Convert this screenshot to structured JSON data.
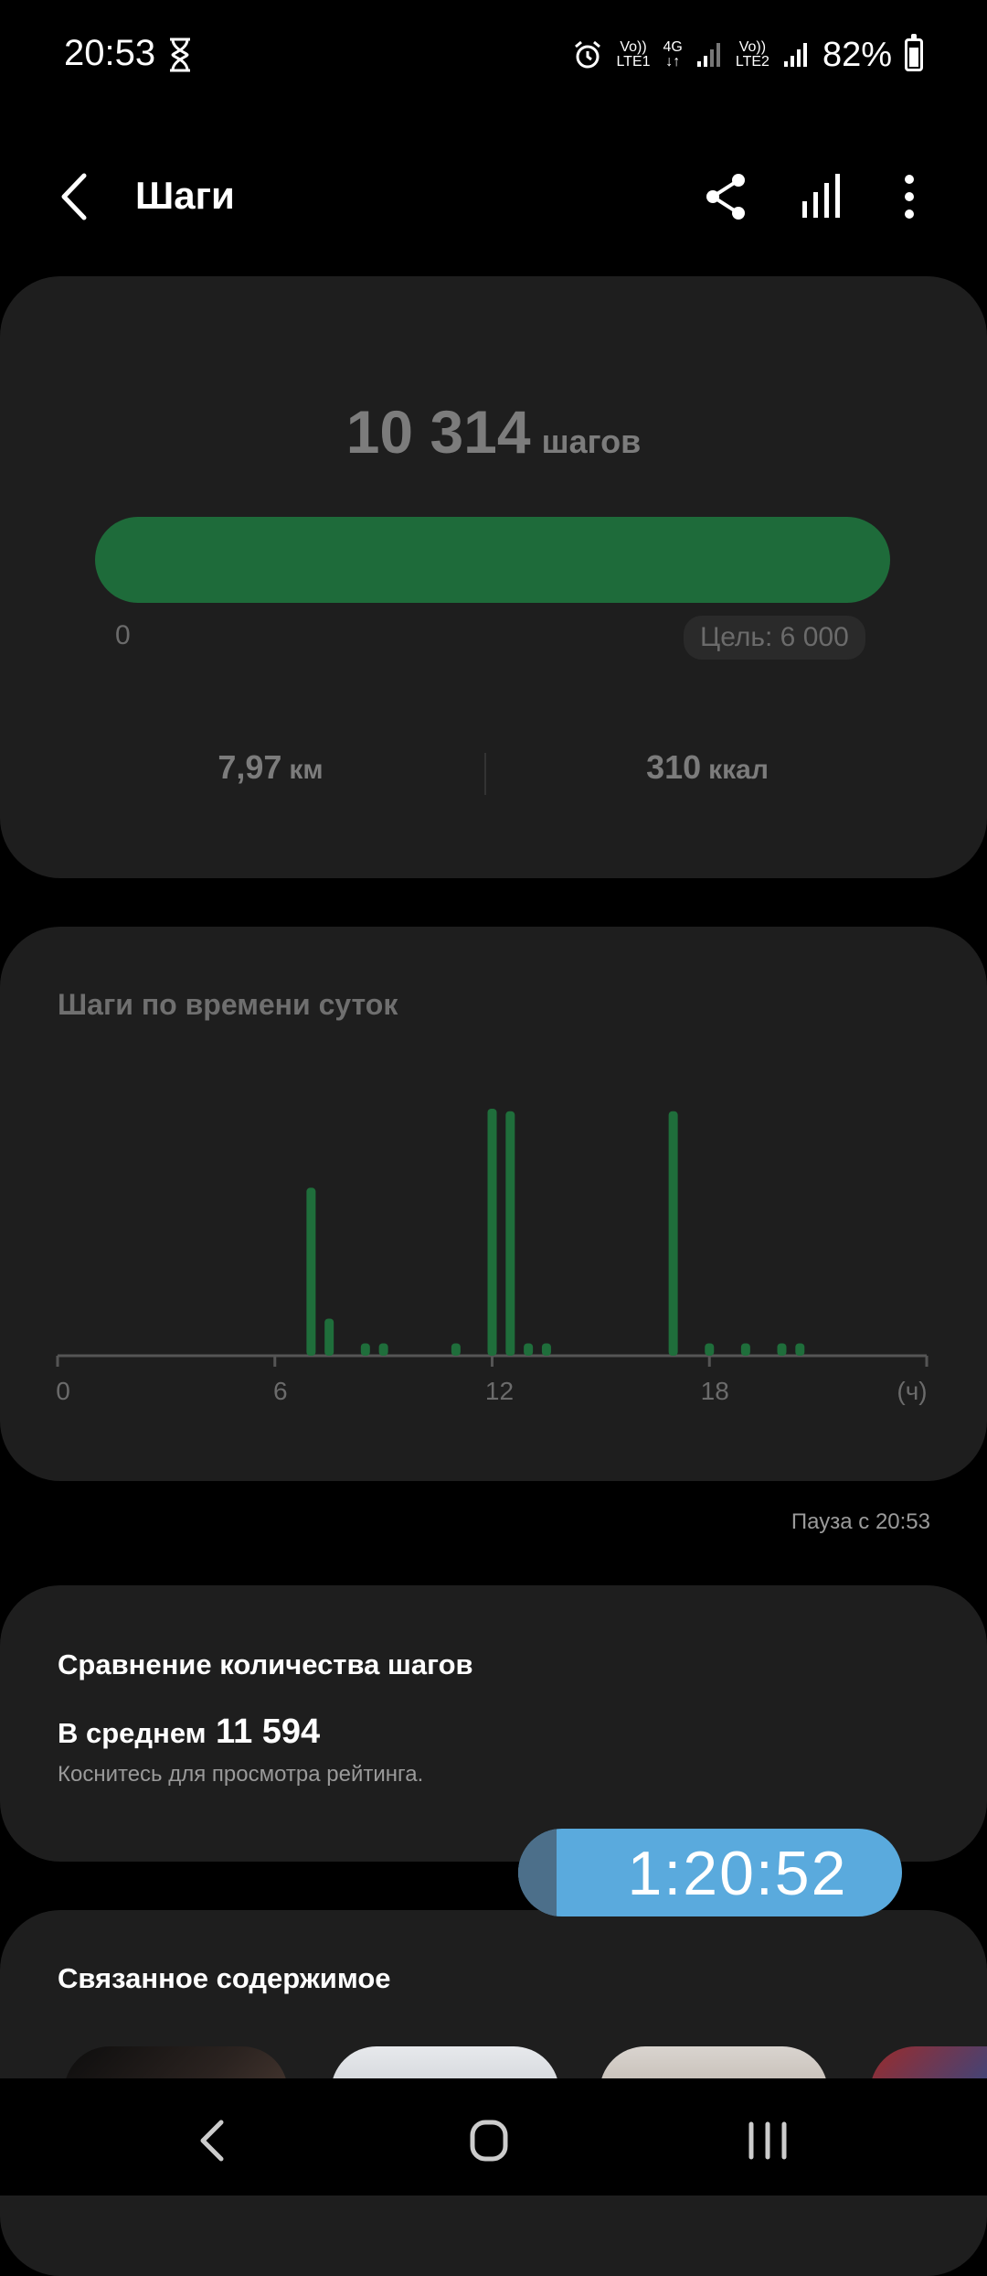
{
  "status_bar": {
    "time": "20:53",
    "sim1_top": "Vo))",
    "sim1_bottom": "LTE1",
    "network": "4G",
    "sim2_top": "Vo))",
    "sim2_bottom": "LTE2",
    "battery": "82%"
  },
  "app_bar": {
    "title": "Шаги"
  },
  "summary": {
    "steps": "10 314",
    "steps_unit": "шагов",
    "progress_fraction": 1.0,
    "scale_start": "0",
    "goal": "Цель: 6 000",
    "distance": "7,97",
    "distance_unit": "км",
    "calories": "310",
    "calories_unit": "ккал"
  },
  "hourly_chart": {
    "title": "Шаги по времени суток",
    "ticks": [
      "0",
      "6",
      "12",
      "18",
      "(ч)"
    ]
  },
  "chart_data": {
    "type": "bar",
    "title": "Шаги по времени суток",
    "xlabel": "(ч)",
    "x_ticks": [
      0,
      6,
      12,
      18
    ],
    "x_range": [
      0,
      24
    ],
    "x": [
      7.0,
      7.5,
      8.5,
      9.0,
      11.0,
      12.0,
      12.5,
      13.0,
      13.5,
      17.0,
      18.0,
      19.0,
      20.0,
      20.5
    ],
    "values": [
      0.68,
      0.15,
      0.05,
      0.05,
      0.05,
      1.0,
      0.99,
      0.05,
      0.05,
      0.99,
      0.05,
      0.05,
      0.05,
      0.05
    ],
    "value_scale": "relative (no y-axis shown)",
    "color": "#1f6e3b"
  },
  "pause_status": "Пауза с 20:53",
  "comparison": {
    "title": "Сравнение количества шагов",
    "avg_label": "В среднем",
    "avg_value": "11 594",
    "hint": "Коснитесь для просмотра рейтинга."
  },
  "timer": {
    "value": "1:20:52"
  },
  "related": {
    "title": "Связанное содержимое"
  },
  "colors": {
    "accent_green": "#1e6b3a",
    "card_bg": "#1e1e1e",
    "timer_blue": "#5aaadd"
  }
}
